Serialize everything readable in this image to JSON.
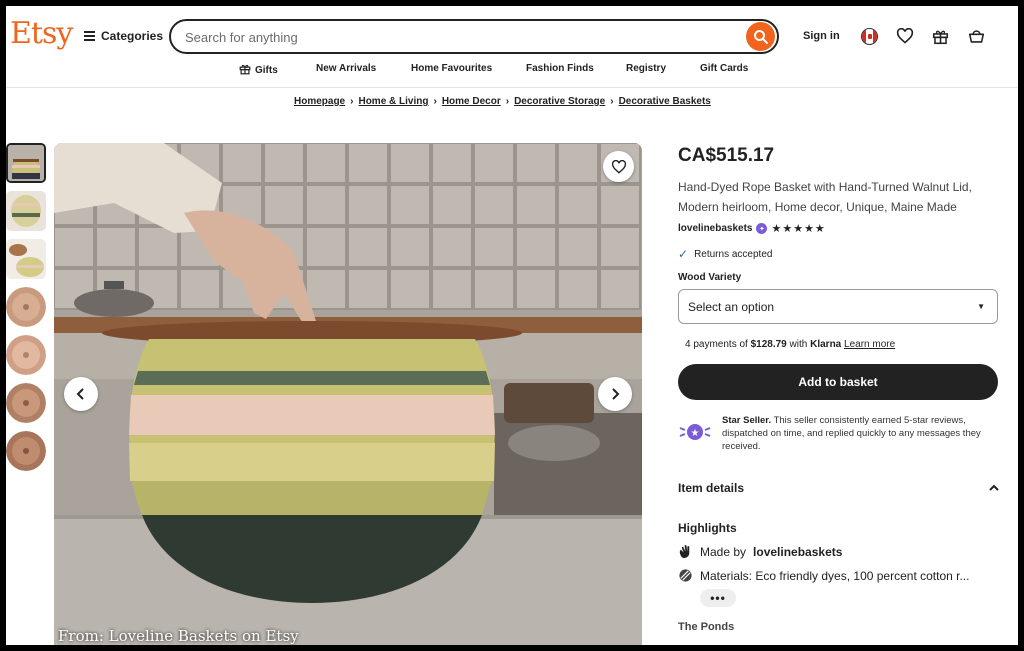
{
  "header": {
    "logo": "Etsy",
    "categories_label": "Categories",
    "search_placeholder": "Search for anything",
    "signin_label": "Sign in",
    "nav": [
      "Gifts",
      "New Arrivals",
      "Home Favourites",
      "Fashion Finds",
      "Registry",
      "Gift Cards"
    ]
  },
  "breadcrumb": [
    "Homepage",
    "Home & Living",
    "Home Decor",
    "Decorative Storage",
    "Decorative Baskets"
  ],
  "gallery": {
    "credit": "From: Loveline Baskets on Etsy"
  },
  "product": {
    "price": "CA$515.17",
    "title": "Hand-Dyed Rope Basket with Hand-Turned Walnut Lid, Modern heirloom, Home decor, Unique, Maine Made",
    "shop_name": "lovelinebaskets",
    "rating_stars": "★★★★★",
    "returns": "Returns accepted",
    "variety_label": "Wood Variety",
    "select_placeholder": "Select an option",
    "klarna_pre": "4 payments of",
    "klarna_amount": "$128.79",
    "klarna_mid": "with",
    "klarna_brand": "Klarna",
    "klarna_link": "Learn more",
    "add_to_basket": "Add to basket",
    "star_seller_title": "Star Seller.",
    "star_seller_text": "This seller consistently earned 5-star reviews, dispatched on time, and replied quickly to any messages they received.",
    "item_details": "Item details",
    "highlights": "Highlights",
    "made_by_pre": "Made by",
    "made_by_shop": "lovelinebaskets",
    "materials": "Materials: Eco friendly dyes, 100 percent cotton r...",
    "more": "•••",
    "cut_off": "The Ponds"
  },
  "colors": {
    "brand": "#f1641e",
    "dark": "#222222",
    "star_seller": "#7b5bd6"
  }
}
